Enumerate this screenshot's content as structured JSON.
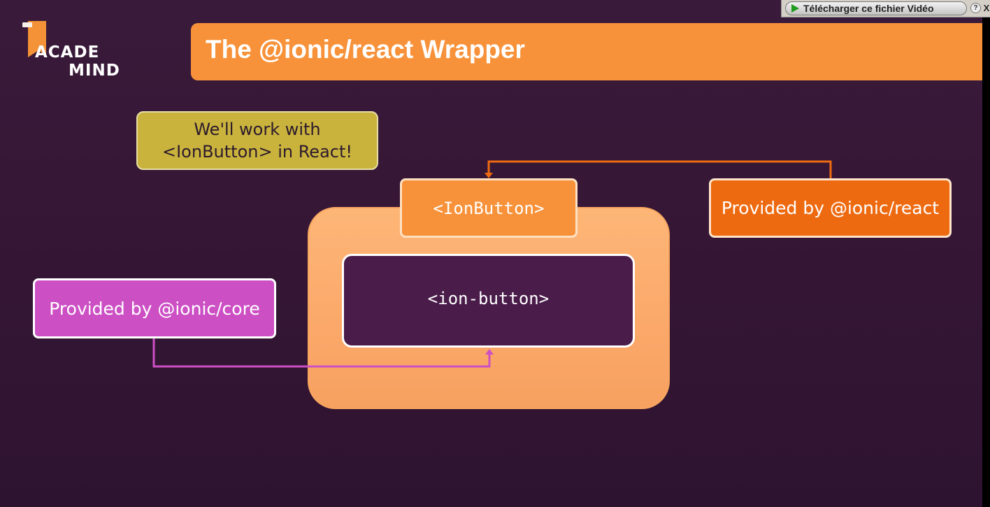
{
  "logo": {
    "line1": "ACADE",
    "line2": "MIND"
  },
  "slide": {
    "title": "The @ionic/react Wrapper"
  },
  "note": {
    "line1": "We'll work with",
    "line2": "<IonButton> in React!"
  },
  "diagram": {
    "react_component": "<IonButton>",
    "web_component": "<ion-button>",
    "provided_react": "Provided by @ionic/react",
    "provided_core": "Provided by @ionic/core"
  },
  "colors": {
    "background": "#341634",
    "banner": "#f7923a",
    "note": "#c9b33d",
    "wrapper": "#fdb677",
    "react_box": "#ee6a10",
    "core_box": "#cc4fc4",
    "react_arrow": "#ee6a10",
    "core_arrow": "#cc4fc4"
  },
  "download_toolbar": {
    "button_label": "Télécharger ce fichier Vidéo",
    "play_icon": "play-icon",
    "help_label": "?",
    "close_label": "X"
  }
}
